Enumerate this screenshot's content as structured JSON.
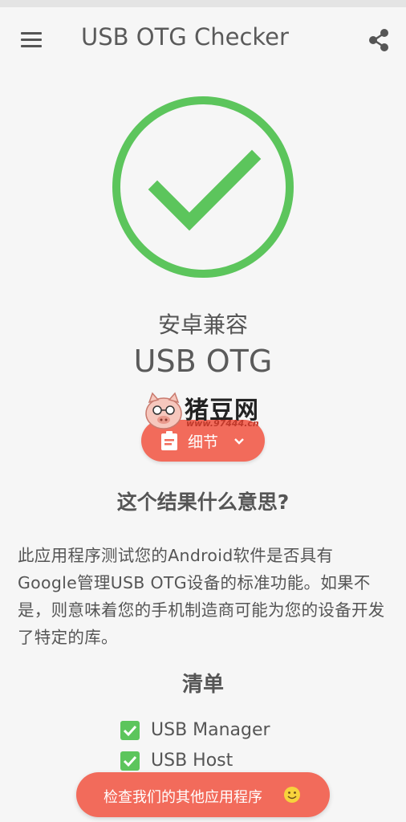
{
  "app_bar": {
    "title": "USB OTG Checker",
    "menu_icon": "menu-icon",
    "share_icon": "share-icon"
  },
  "result": {
    "status_icon": "check-circle-icon",
    "status_color": "#5cc55c",
    "label": "安卓兼容",
    "value": "USB OTG"
  },
  "details_button": {
    "label": "细节",
    "icon": "clipboard-icon",
    "chevron": "chevron-down-icon",
    "color": "#f26b5b"
  },
  "watermark": {
    "text": "猪豆网",
    "url": "www.97444.cn"
  },
  "explanation": {
    "heading": "这个结果什么意思?",
    "body": "此应用程序测试您的Android软件是否具有Google管理USB OTG设备的标准功能。如果不是，则意味着您的手机制造商可能为您的设备开发了特定的库。"
  },
  "checklist": {
    "heading": "清单",
    "items": [
      {
        "label": "USB Manager",
        "checked": true
      },
      {
        "label": "USB Host",
        "checked": true
      }
    ]
  },
  "footer_button": {
    "label": "检查我们的其他应用程序",
    "icon": "smile-icon"
  }
}
